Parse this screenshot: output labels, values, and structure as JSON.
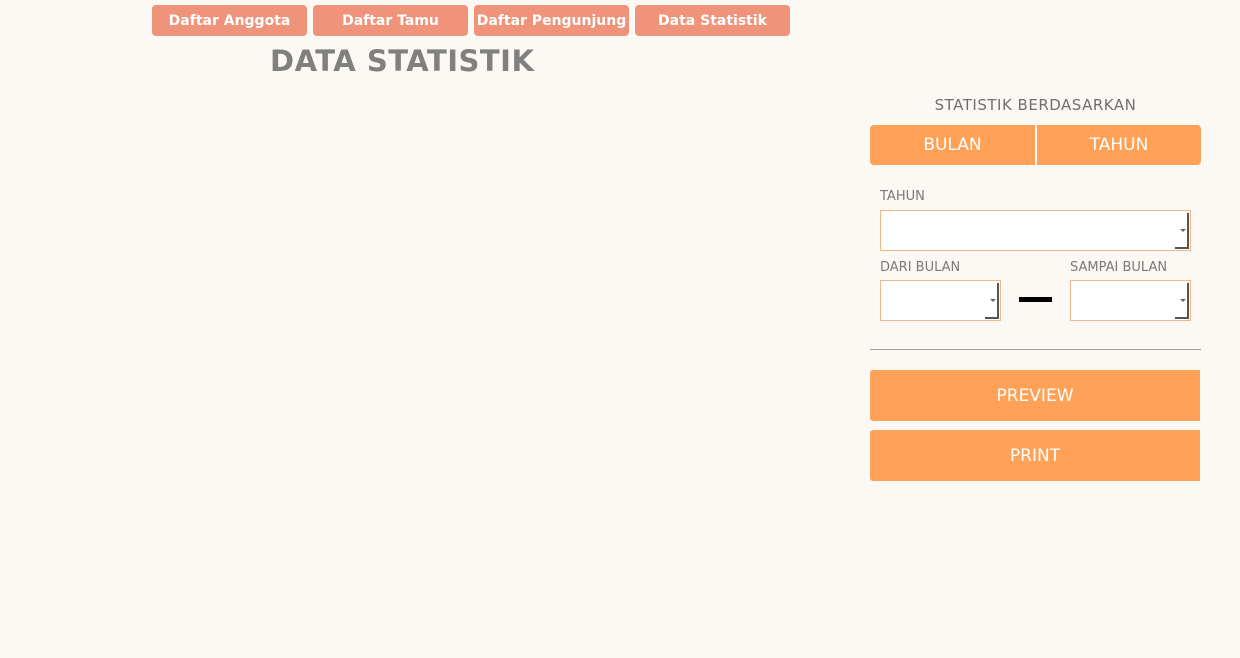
{
  "nav": {
    "items": [
      {
        "label": "Daftar Anggota"
      },
      {
        "label": "Daftar Tamu"
      },
      {
        "label": "Daftar Pengunjung"
      },
      {
        "label": "Data Statistik"
      }
    ]
  },
  "page": {
    "title": "DATA STATISTIK"
  },
  "filter": {
    "heading": "STATISTIK BERDASARKAN",
    "mode_bulan": "BULAN",
    "mode_tahun": "TAHUN",
    "tahun_label": "TAHUN",
    "tahun_value": "",
    "dari_bulan_label": "DARI BULAN",
    "dari_bulan_value": "",
    "sampai_bulan_label": "SAMPAI BULAN",
    "sampai_bulan_value": ""
  },
  "actions": {
    "preview": "PREVIEW",
    "print": "PRINT"
  },
  "colors": {
    "background": "#fcf8f3",
    "nav_button": "#ef937b",
    "accent": "#ffa156",
    "title_text": "#808080"
  }
}
